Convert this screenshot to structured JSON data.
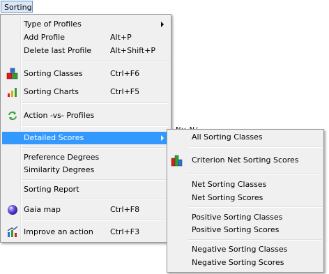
{
  "menubar": {
    "sorting_label": "Sorting"
  },
  "background": {
    "fragment": "Nv    N/"
  },
  "main_menu": {
    "type_of_profiles": "Type of Profiles",
    "add_profile": "Add Profile",
    "add_profile_shortcut": "Alt+P",
    "delete_last_profile": "Delete last Profile",
    "delete_last_profile_shortcut": "Alt+Shift+P",
    "sorting_classes": "Sorting Classes",
    "sorting_classes_shortcut": "Ctrl+F6",
    "sorting_charts": "Sorting Charts",
    "sorting_charts_shortcut": "Ctrl+F5",
    "action_vs_profiles": "Action -vs- Profiles",
    "detailed_scores": "Detailed Scores",
    "preference_degrees": "Preference Degrees",
    "similarity_degrees": "Similarity Degrees",
    "sorting_report": "Sorting Report",
    "gaia_map": "Gaia map",
    "gaia_map_shortcut": "Ctrl+F8",
    "improve_an_action": "Improve an action",
    "improve_an_action_shortcut": "Ctrl+F3"
  },
  "sub_menu": {
    "all_sorting_classes": "All Sorting Classes",
    "criterion_net_sorting_scores": "Criterion Net Sorting Scores",
    "net_sorting_classes": "Net Sorting Classes",
    "net_sorting_scores": "Net Sorting Scores",
    "positive_sorting_classes": "Positive Sorting Classes",
    "positive_sorting_scores": "Positive Sorting Scores",
    "negative_sorting_classes": "Negative Sorting Classes",
    "negative_sorting_scores": "Negative Sorting Scores"
  },
  "icons": {
    "sorting_classes": "colored-cubes-icon",
    "sorting_charts": "bar-chart-icon",
    "action_vs_profiles": "green-refresh-arrows-icon",
    "gaia_map": "purple-globe-icon",
    "improve_an_action": "improve-chart-icon",
    "criterion_net_sorting_scores": "colored-bars-icon"
  }
}
